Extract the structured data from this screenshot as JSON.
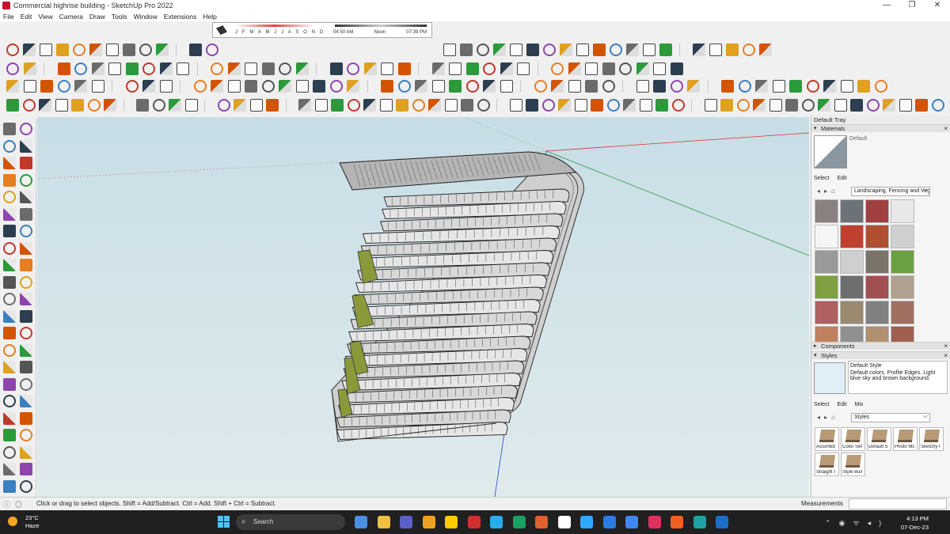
{
  "window": {
    "title": "Commercial highrise building - SketchUp Pro 2022",
    "controls": [
      "—",
      "❐",
      "✕"
    ]
  },
  "menu": [
    "File",
    "Edit",
    "View",
    "Camera",
    "Draw",
    "Tools",
    "Window",
    "Extensions",
    "Help"
  ],
  "shadow_widget": {
    "months": "J F M A M J J A S O N D",
    "time_start": "04:50 AM",
    "time_mid": "Noon",
    "time_end": "07:39 PM"
  },
  "tray": {
    "title": "Default Tray",
    "materials": {
      "header": "Materials",
      "current": "Default",
      "tabs": [
        "Select",
        "Edit"
      ],
      "collection": "Landscaping, Fencing and Vegetation"
    },
    "components_header": "Components",
    "styles": {
      "header": "Styles",
      "current_name": "Default Style",
      "description": "Default colors. Profile Edges. Light blue sky and brown background.",
      "tabs": [
        "Select",
        "Edit",
        "Mix"
      ],
      "collection": "Styles",
      "items": [
        "Assorted",
        "Color Set",
        "Default S",
        "Photo Mc",
        "Sketchy I",
        "Straight I",
        "Style Buil"
      ]
    }
  },
  "status": {
    "message": "Click or drag to select objects. Shift = Add/Subtract. Ctrl = Add. Shift + Ctrl = Subtract.",
    "measurements_label": "Measurements"
  },
  "taskbar": {
    "temperature": "23°C",
    "weather": "Haze",
    "search_placeholder": "Search",
    "time": "4:13 PM",
    "date": "07-Dec-23"
  },
  "colors": {
    "sky": "#c7dde6",
    "axis_red": "#d83030",
    "axis_green": "#2a9a3a",
    "axis_blue": "#2040c0",
    "taskbar": "#202020"
  }
}
